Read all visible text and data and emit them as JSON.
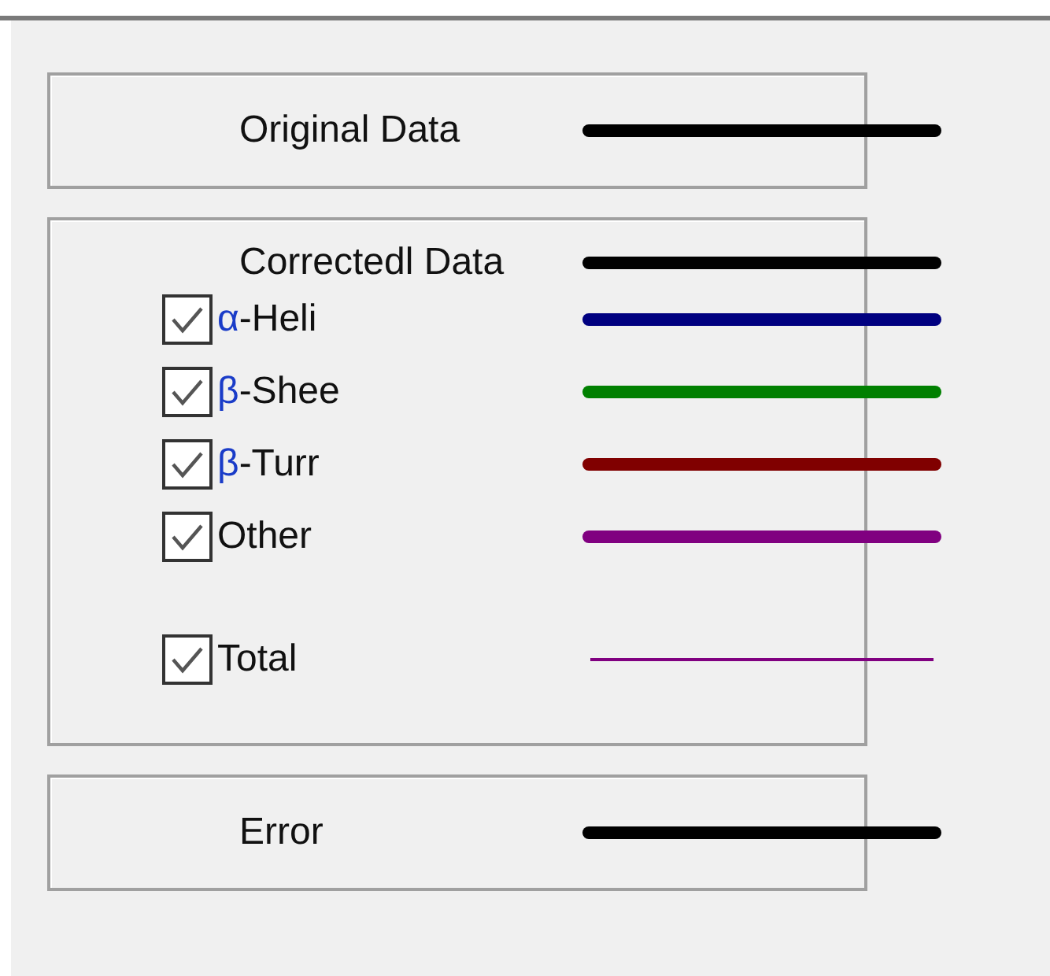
{
  "groups": [
    {
      "header": {
        "label": "Original Data",
        "line": {
          "color": "#000000",
          "kind": "thick"
        }
      }
    },
    {
      "header": {
        "label": "Correctedl Data",
        "line": {
          "color": "#000000",
          "kind": "thick"
        }
      },
      "rows": [
        {
          "symbol": "α",
          "label": "-Heli",
          "checked": true,
          "line": {
            "color": "#000080",
            "kind": "thick"
          }
        },
        {
          "symbol": "β",
          "label": "-Shee",
          "checked": true,
          "line": {
            "color": "#008000",
            "kind": "thick"
          }
        },
        {
          "symbol": "β",
          "label": "-Turr",
          "checked": true,
          "line": {
            "color": "#800000",
            "kind": "thick"
          }
        },
        {
          "label": "Other",
          "checked": true,
          "line": {
            "color": "#800080",
            "kind": "thick"
          }
        },
        {
          "label": "Total",
          "checked": true,
          "line": {
            "color": "#800080",
            "kind": "thin"
          }
        }
      ]
    },
    {
      "header": {
        "label": "Error",
        "line": {
          "color": "#000000",
          "kind": "thick"
        }
      }
    }
  ]
}
